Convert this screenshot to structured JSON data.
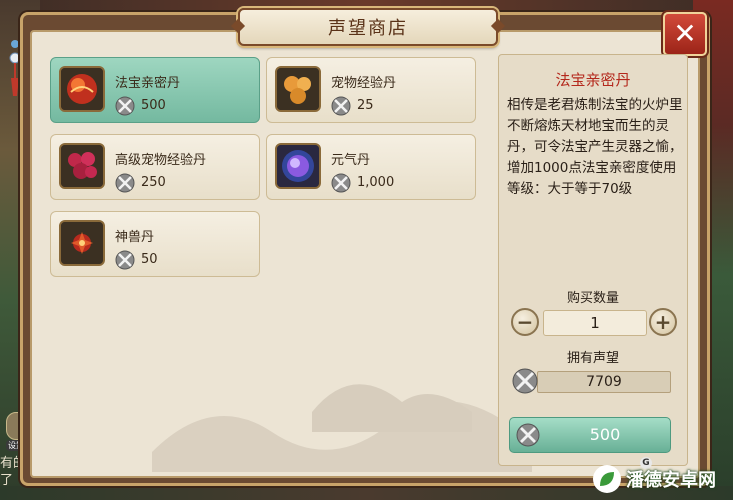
{
  "window": {
    "title": "声望商店"
  },
  "items": [
    {
      "name": "法宝亲密丹",
      "price": "500",
      "icon": "red-fire-orb",
      "selected": true
    },
    {
      "name": "宠物经验丹",
      "price": "25",
      "icon": "orange-pills",
      "selected": false
    },
    {
      "name": "高级宠物经验丹",
      "price": "250",
      "icon": "red-berry-cluster",
      "selected": false
    },
    {
      "name": "元气丹",
      "price": "1,000",
      "icon": "blue-purple-glow-orb",
      "selected": false
    },
    {
      "name": "神兽丹",
      "price": "50",
      "icon": "red-flower-emblem",
      "selected": false
    }
  ],
  "detail": {
    "title": "法宝亲密丹",
    "description": "相传是老君炼制法宝的火炉里不断熔炼天材地宝而生的灵丹，可令法宝产生灵器之愉，增加1000点法宝亲密度使用等级：大于等于70级",
    "quantity_label": "购买数量",
    "quantity_value": "1",
    "reputation_label": "拥有声望",
    "reputation_value": "7709",
    "buy_label": "500"
  },
  "side": {
    "chat_line1": "有的",
    "chat_line2": "了",
    "small_label": "设置"
  },
  "watermark": {
    "text": "潘德安卓网",
    "badge": "G"
  },
  "colors": {
    "selected": "#74b9a0",
    "title_red": "#b4281c",
    "panel_bg": "#ece4d4",
    "close_red": "#c0392b"
  }
}
